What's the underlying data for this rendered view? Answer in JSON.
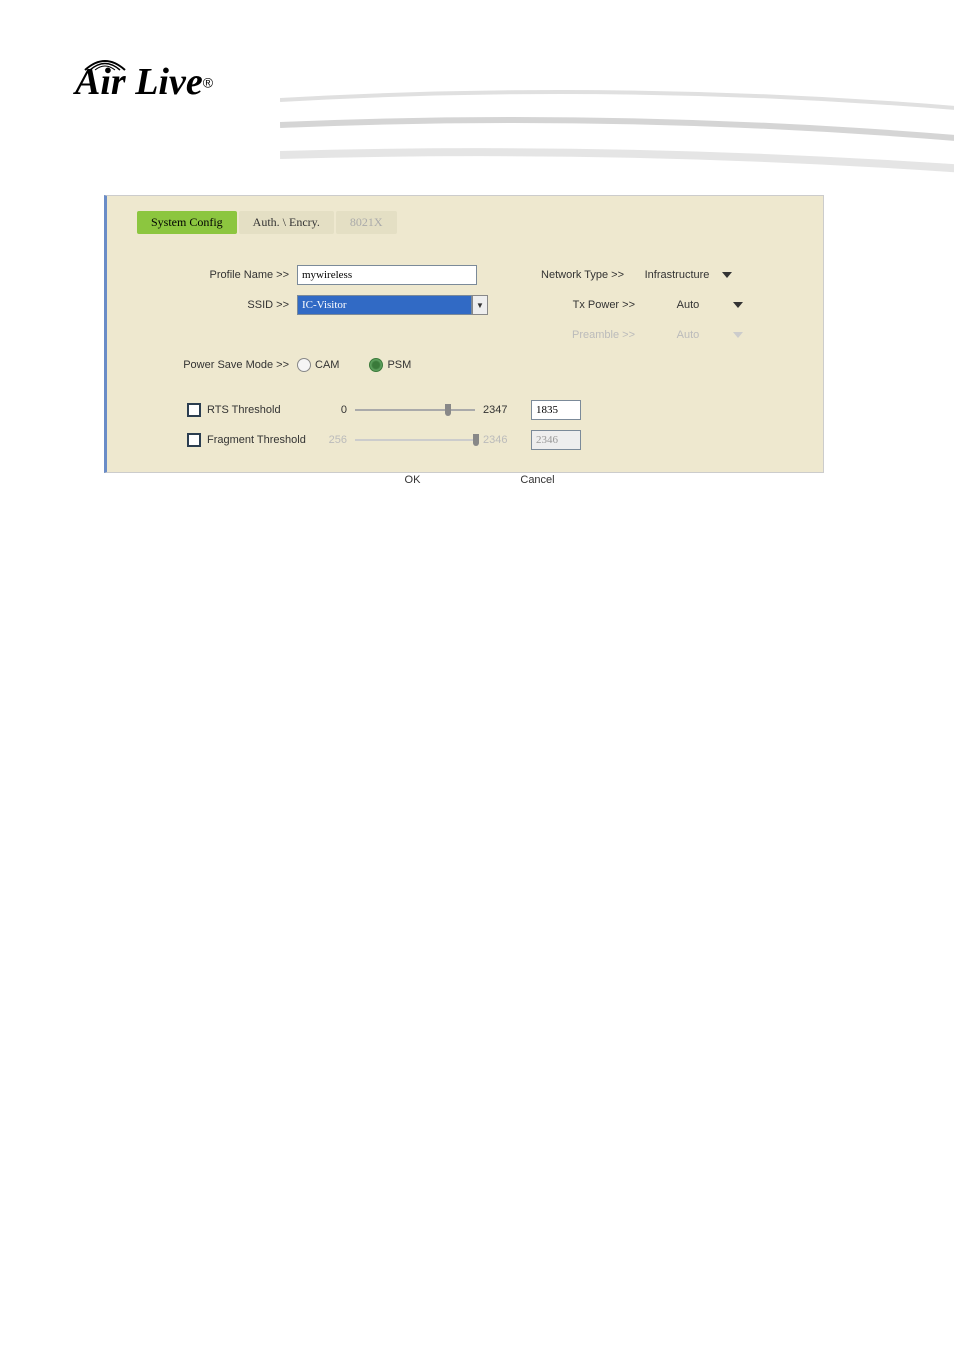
{
  "logo": {
    "brand": "Air Live",
    "registered": "®"
  },
  "tabs": {
    "system_config": "System Config",
    "auth_encry": "Auth. \\ Encry.",
    "dot1x": "8021X"
  },
  "form": {
    "profile_name": {
      "label": "Profile Name >>",
      "value": "mywireless"
    },
    "ssid": {
      "label": "SSID >>",
      "value": "IC-Visitor"
    },
    "network_type": {
      "label": "Network Type >>",
      "value": "Infrastructure"
    },
    "tx_power": {
      "label": "Tx Power >>",
      "value": "Auto"
    },
    "preamble": {
      "label": "Preamble >>",
      "value": "Auto"
    },
    "power_save": {
      "label": "Power Save Mode >>",
      "cam": "CAM",
      "psm": "PSM"
    },
    "rts": {
      "label": "RTS Threshold",
      "min": "0",
      "max": "2347",
      "value": "1835"
    },
    "fragment": {
      "label": "Fragment Threshold",
      "min": "256",
      "max": "2346",
      "value": "2346"
    }
  },
  "buttons": {
    "ok": "OK",
    "cancel": "Cancel"
  }
}
